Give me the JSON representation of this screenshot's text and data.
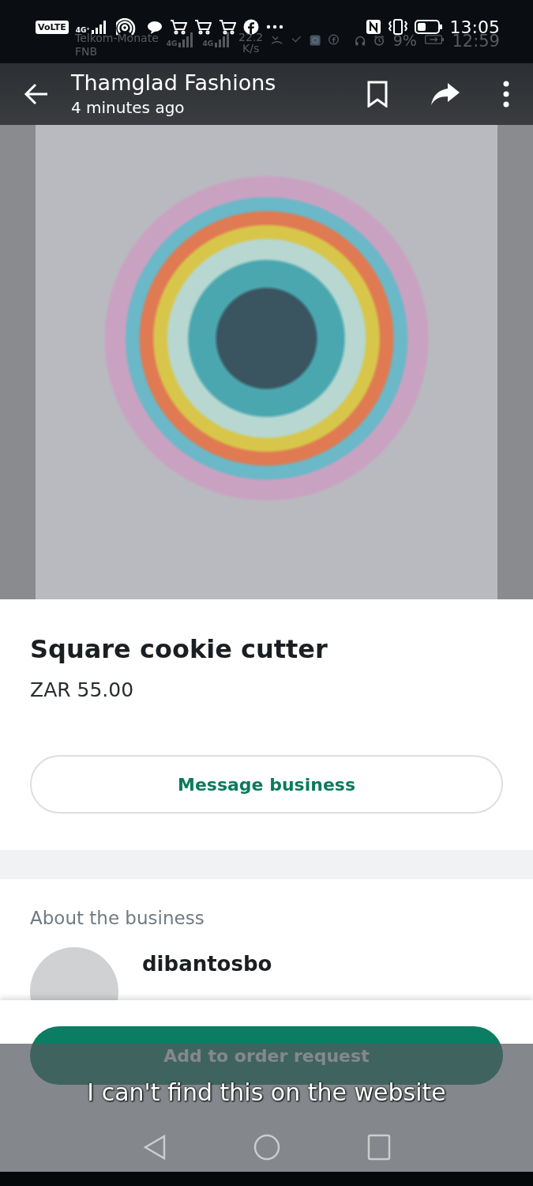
{
  "status_bar": {
    "badge": "VoLTE",
    "signal_label": "4G⁺",
    "time": "13:05"
  },
  "ghost_status_bar": {
    "carriers": [
      "Telkom-Monate",
      "FNB"
    ],
    "signal_labels": [
      "4G",
      "4G"
    ],
    "speed": "22.2 K/s",
    "battery_percent": "9%",
    "time": "12:59"
  },
  "header": {
    "title": "Thamglad Fashions",
    "subtitle": "4 minutes ago"
  },
  "product": {
    "name": "Square cookie cutter",
    "price": "ZAR 55.00",
    "message_button": "Message business"
  },
  "about": {
    "heading": "About the business",
    "business_name": "dibantosbo"
  },
  "order_button": "Add to order request",
  "caption": "I can't find this on the website"
}
